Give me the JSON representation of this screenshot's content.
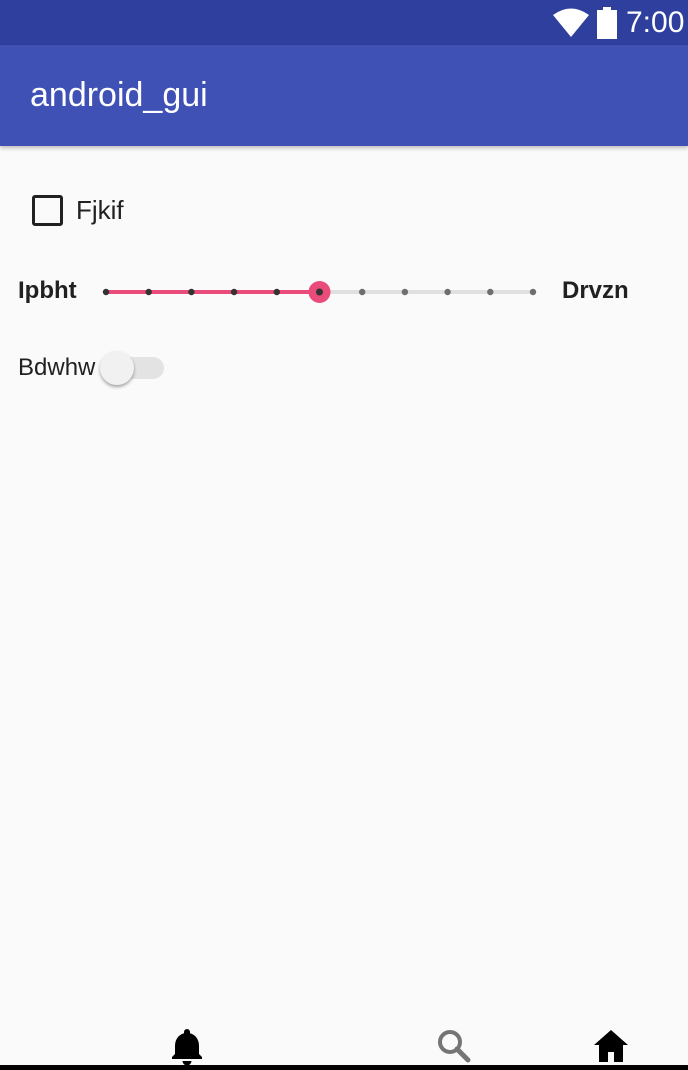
{
  "status_bar": {
    "time": "7:00",
    "icons": [
      "wifi-icon",
      "battery-icon"
    ],
    "background": "#2e3f9e"
  },
  "app_bar": {
    "title": "android_gui",
    "background": "#3f51b5"
  },
  "form": {
    "checkbox": {
      "label": "Fjkif",
      "checked": false
    },
    "slider": {
      "start_label": "Ipbht",
      "end_label": "Drvzn",
      "min": 0,
      "max": 10,
      "step": 1,
      "value": 5,
      "accent": "#e94b7b"
    },
    "switch": {
      "label": "Bdwhw",
      "on": false
    }
  },
  "bottom_nav": {
    "items": [
      {
        "icon": "bell-icon",
        "active": true
      },
      {
        "icon": "search-icon",
        "active": false
      },
      {
        "icon": "home-icon",
        "active": true
      }
    ]
  }
}
